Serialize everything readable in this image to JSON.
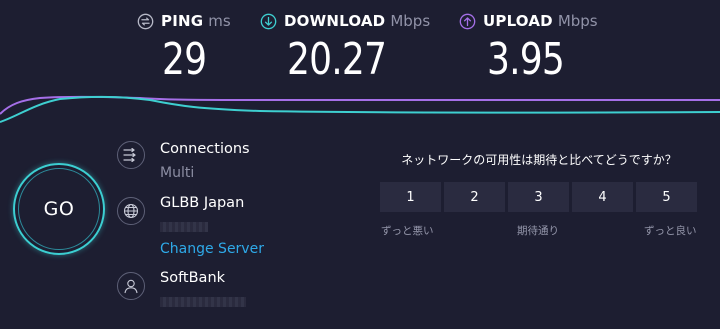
{
  "ping": {
    "title": "PING",
    "unit": "ms",
    "value": "29",
    "color": "#b7b9c7",
    "icon": "ping-icon"
  },
  "download": {
    "title": "DOWNLOAD",
    "unit": "Mbps",
    "value": "20.27",
    "color": "#3ecfd0",
    "icon": "download-arrow-icon"
  },
  "upload": {
    "title": "UPLOAD",
    "unit": "Mbps",
    "value": "3.95",
    "color": "#a56fe8",
    "icon": "upload-arrow-icon"
  },
  "go_button": {
    "label": "GO"
  },
  "connections": {
    "title": "Connections",
    "value": "Multi",
    "icon": "connections-icon"
  },
  "server": {
    "name": "GLBB Japan",
    "change_label": "Change Server",
    "icon": "globe-icon"
  },
  "provider": {
    "name": "SoftBank",
    "icon": "user-icon"
  },
  "survey": {
    "question": "ネットワークの可用性は期待と比べてどうですか？",
    "ratings": [
      "1",
      "2",
      "3",
      "4",
      "5"
    ],
    "label_low": "ずっと悪い",
    "label_mid": "期待通り",
    "label_high": "ずっと良い"
  },
  "colors": {
    "background": "#1d1e31",
    "accent_cyan": "#3ecfd0",
    "accent_purple": "#a56fe8",
    "link_blue": "#2ea9e8"
  }
}
